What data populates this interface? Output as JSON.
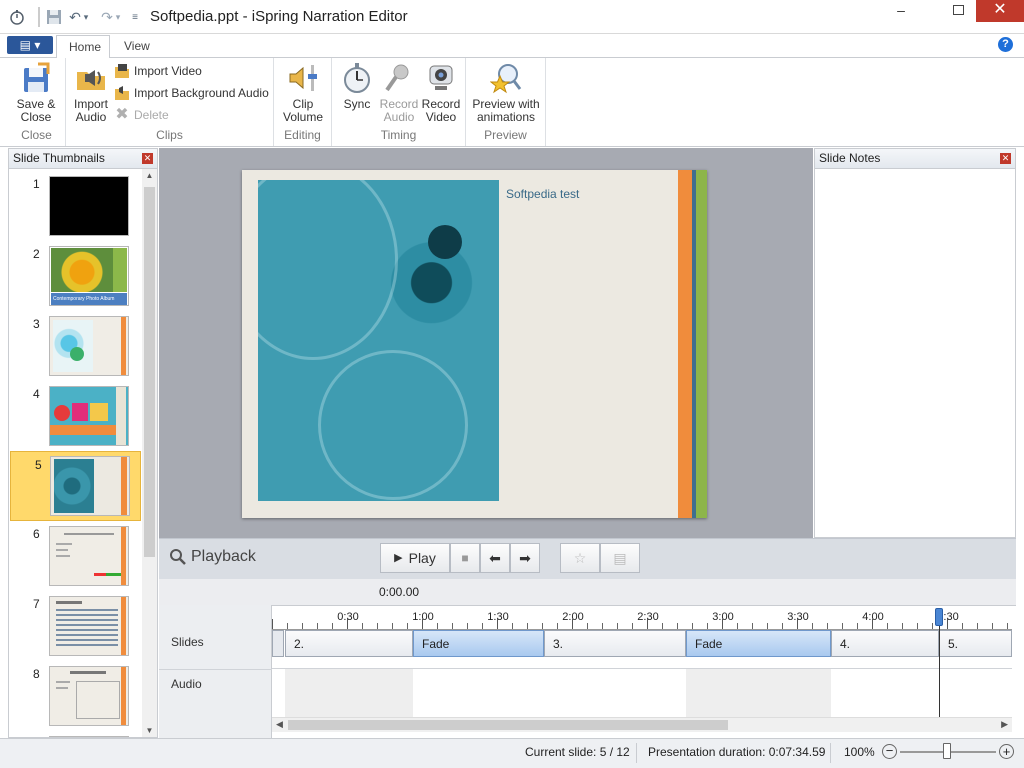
{
  "window": {
    "title": "Softpedia.ppt - iSpring Narration Editor"
  },
  "ribbon": {
    "tabs": [
      "Home",
      "View"
    ],
    "close_group": {
      "save_close": "Save &\nClose",
      "label": "Close"
    },
    "clips_group": {
      "import_audio": "Import\nAudio",
      "import_video": "Import Video",
      "import_bg_audio": "Import Background Audio",
      "delete": "Delete",
      "label": "Clips"
    },
    "editing_group": {
      "clip_volume": "Clip\nVolume",
      "label": "Editing"
    },
    "timing_group": {
      "sync": "Sync",
      "record_audio": "Record\nAudio",
      "record_video": "Record\nVideo",
      "label": "Timing"
    },
    "preview_group": {
      "preview": "Preview with\nanimations",
      "label": "Preview"
    }
  },
  "thumbnails": {
    "title": "Slide Thumbnails",
    "numbers": [
      "1",
      "2",
      "3",
      "4",
      "5",
      "6",
      "7",
      "8"
    ],
    "selected_index": 5,
    "captions": {
      "s2": "Contemporary Photo Album"
    }
  },
  "slide": {
    "title": "Softpedia test"
  },
  "notes": {
    "title": "Slide Notes"
  },
  "playback": {
    "label": "Playback",
    "play": "Play",
    "time": "0:00.00"
  },
  "timeline": {
    "ticks": [
      "0:30",
      "1:00",
      "1:30",
      "2:00",
      "2:30",
      "3:00",
      "3:30",
      "4:00",
      "4:30"
    ],
    "tracks": [
      "Slides",
      "Audio"
    ],
    "clips": [
      "2.",
      "Fade",
      "3.",
      "Fade",
      "4.",
      "5."
    ]
  },
  "status": {
    "current_slide": "Current slide: 5 / 12",
    "duration": "Presentation duration: 0:07:34.59",
    "zoom": "100%"
  },
  "colors": {
    "accent": "#2b579a",
    "selected": "#ffd96b",
    "fade": "#a9c9ef",
    "close": "#c0392b"
  }
}
